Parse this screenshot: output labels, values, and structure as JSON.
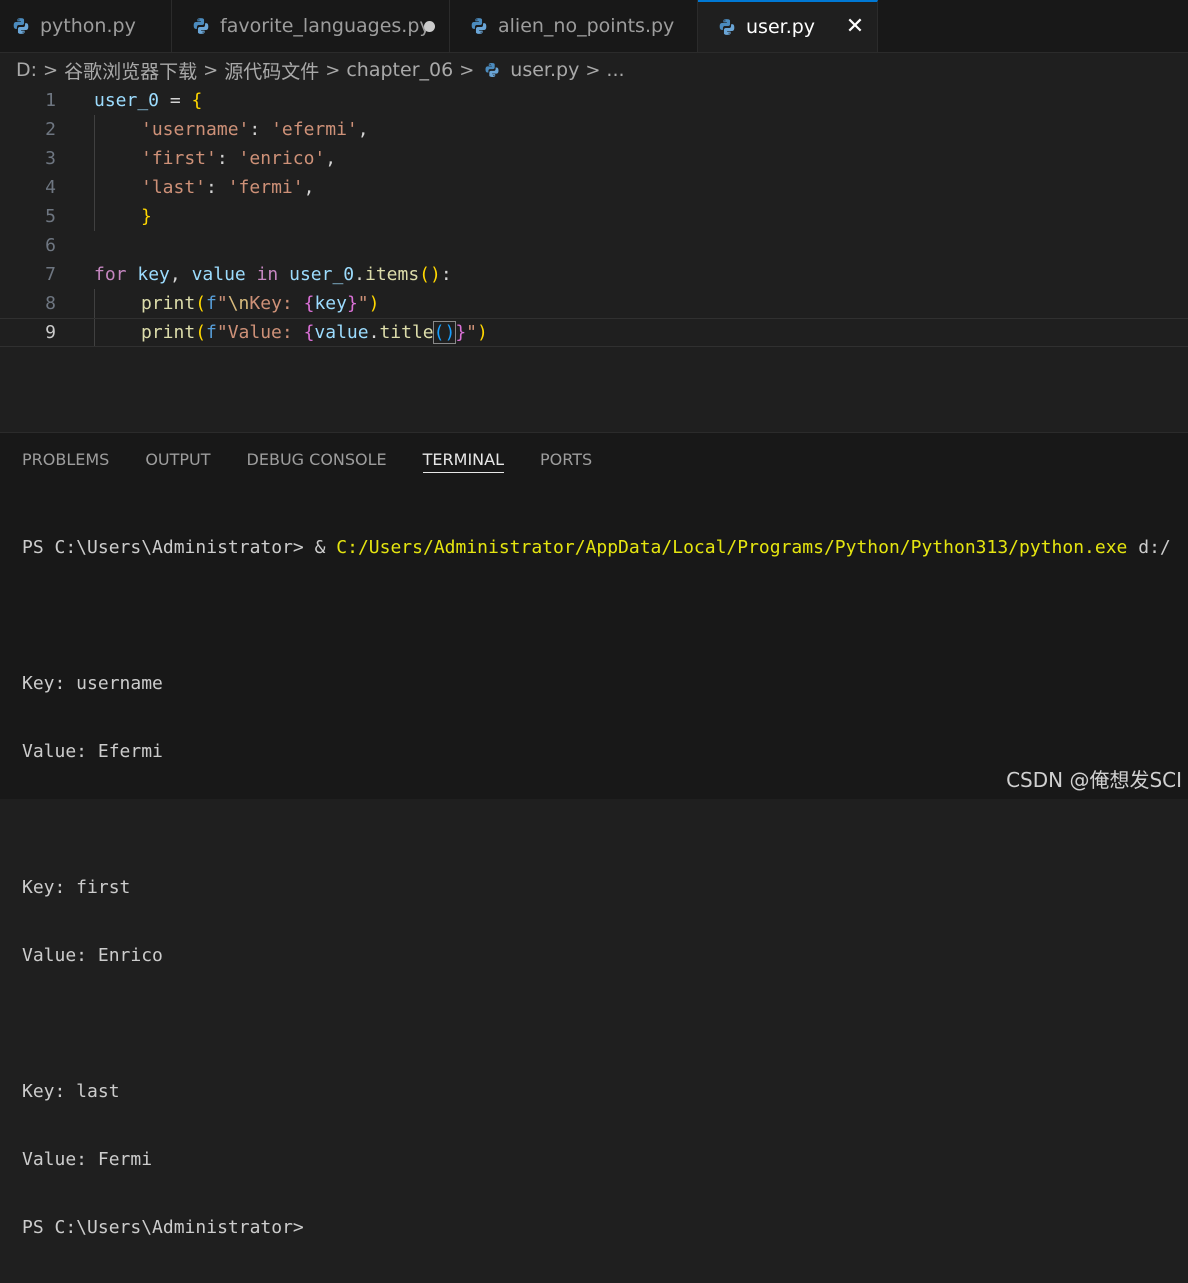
{
  "tabs": [
    {
      "label": "python.py",
      "dirty": false,
      "active": false
    },
    {
      "label": "favorite_languages.py",
      "dirty": true,
      "active": false
    },
    {
      "label": "alien_no_points.py",
      "dirty": false,
      "active": false
    },
    {
      "label": "user.py",
      "dirty": false,
      "active": true
    }
  ],
  "tab_close_glyph": "✕",
  "breadcrumb": {
    "parts": [
      "D:",
      "谷歌浏览器下载",
      "源代码文件",
      "chapter_06",
      "user.py",
      "..."
    ],
    "separator": ">"
  },
  "editor": {
    "line_numbers": [
      "1",
      "2",
      "3",
      "4",
      "5",
      "6",
      "7",
      "8",
      "9"
    ],
    "current_line": "9",
    "lines": {
      "l1": {
        "a": "user_0",
        "b": " = ",
        "c": "{"
      },
      "l2": {
        "a": "'username'",
        "b": ": ",
        "c": "'efermi'",
        "d": ","
      },
      "l3": {
        "a": "'first'",
        "b": ": ",
        "c": "'enrico'",
        "d": ","
      },
      "l4": {
        "a": "'last'",
        "b": ": ",
        "c": "'fermi'",
        "d": ","
      },
      "l5": {
        "a": "}"
      },
      "l7": {
        "kw1": "for",
        "v1": " key",
        "p1": ", ",
        "v2": "value",
        "kw2": " in ",
        "v3": "user_0",
        "p2": ".",
        "fn": "items",
        "b1": "()",
        "p3": ":"
      },
      "l8": {
        "fn": "print",
        "b1": "(",
        "f": "f",
        "q1": "\"",
        "esc": "\\n",
        "s1": "Key: ",
        "b2": "{",
        "v": "key",
        "b3": "}",
        "q2": "\"",
        "b4": ")"
      },
      "l9": {
        "fn": "print",
        "b1": "(",
        "f": "f",
        "s1": "\"Value: ",
        "b2": "{",
        "v": "value",
        "p": ".",
        "fn2": "title",
        "b3": "()",
        "b4": "}",
        "q2": "\"",
        "b5": ")"
      }
    }
  },
  "panel": {
    "tabs": [
      "PROBLEMS",
      "OUTPUT",
      "DEBUG CONSOLE",
      "TERMINAL",
      "PORTS"
    ],
    "active_tab": "TERMINAL"
  },
  "terminal": {
    "prompt1": "PS C:\\Users\\Administrator> & ",
    "command_path": "C:/Users/Administrator/AppData/Local/Programs/Python/Python313/python.exe",
    "command_rest": " d:/",
    "lines": [
      "Key: username",
      "Value: Efermi",
      "",
      "Key: first",
      "Value: Enrico",
      "",
      "Key: last",
      "Value: Fermi"
    ],
    "final_prompt": "PS C:\\Users\\Administrator>"
  },
  "watermark": "CSDN @俺想发SCI",
  "colors": {
    "accent": "#0078d4",
    "string": "#ce9178",
    "keyword": "#c586c0",
    "variable": "#9cdcfe",
    "function": "#dcdcaa",
    "terminal_path": "#e5e510"
  }
}
